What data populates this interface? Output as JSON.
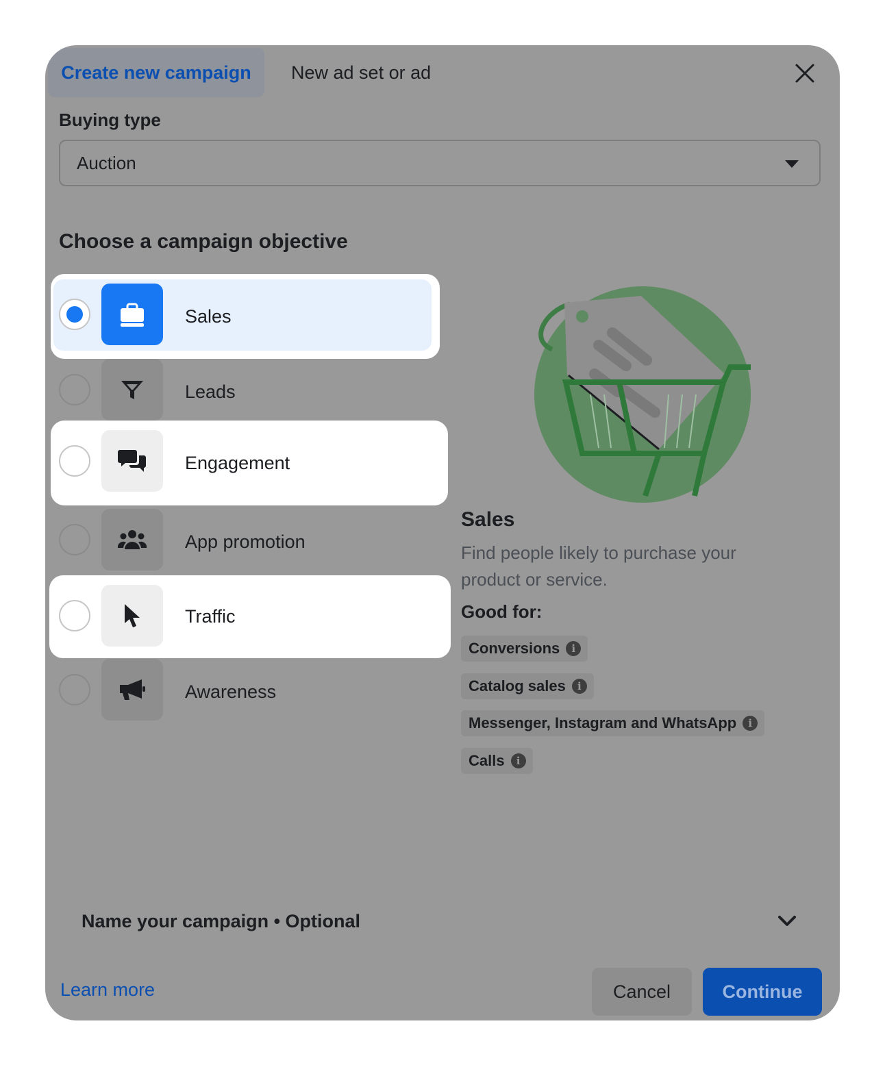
{
  "tabs": {
    "active_label": "Create new campaign",
    "other_label": "New ad set or ad"
  },
  "buying_type": {
    "label": "Buying type",
    "value": "Auction"
  },
  "objective": {
    "title": "Choose a campaign objective",
    "options": [
      {
        "label": "Sales",
        "icon": "shopping-bag-icon",
        "selected": true
      },
      {
        "label": "Leads",
        "icon": "funnel-icon",
        "selected": false
      },
      {
        "label": "Engagement",
        "icon": "chat-bubbles-icon",
        "selected": false
      },
      {
        "label": "App promotion",
        "icon": "people-group-icon",
        "selected": false
      },
      {
        "label": "Traffic",
        "icon": "cursor-icon",
        "selected": false
      },
      {
        "label": "Awareness",
        "icon": "megaphone-icon",
        "selected": false
      }
    ]
  },
  "detail": {
    "title": "Sales",
    "description": "Find people likely to purchase your product or service.",
    "good_for_label": "Good for:",
    "chips": [
      "Conversions",
      "Catalog sales",
      "Messenger, Instagram and WhatsApp",
      "Calls"
    ],
    "info_glyph": "i"
  },
  "name_section": {
    "label": "Name your campaign • Optional"
  },
  "footer": {
    "learn_more": "Learn more",
    "cancel": "Cancel",
    "continue": "Continue"
  },
  "colors": {
    "accent": "#1877f2",
    "primary_button": "#0b4fb0",
    "overlay": "#999999",
    "illustration_green": "#5f8b62"
  }
}
